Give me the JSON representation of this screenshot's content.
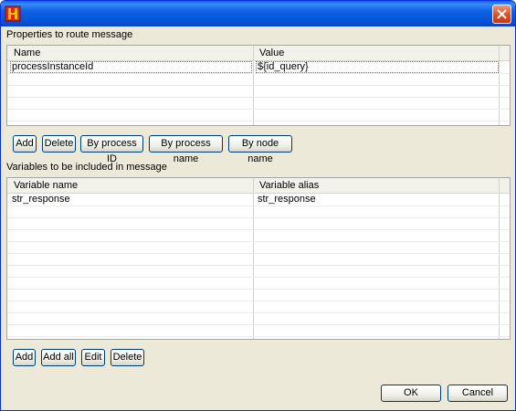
{
  "titlebar": {
    "icon": "app-logo-icon",
    "close_icon": "close-icon"
  },
  "properties": {
    "section_label": "Properties to route message",
    "columns": [
      "Name",
      "Value"
    ],
    "rows": [
      {
        "name": "processInstanceId",
        "value": "${id_query}"
      }
    ],
    "buttons": {
      "add": "Add",
      "delete": "Delete",
      "by_process_id": "By process ID",
      "by_process_name": "By process name",
      "by_node_name": "By node name"
    }
  },
  "variables": {
    "section_label": "Variables to be included in message",
    "columns": [
      "Variable name",
      "Variable alias"
    ],
    "rows": [
      {
        "name": "str_response",
        "alias": "str_response"
      }
    ],
    "buttons": {
      "add": "Add",
      "add_all": "Add all",
      "edit": "Edit",
      "delete": "Delete"
    }
  },
  "dialog_buttons": {
    "ok": "OK",
    "cancel": "Cancel"
  },
  "colors": {
    "titlebar": "#0552d8",
    "window_bg": "#ece9d8",
    "close": "#d5532c"
  }
}
